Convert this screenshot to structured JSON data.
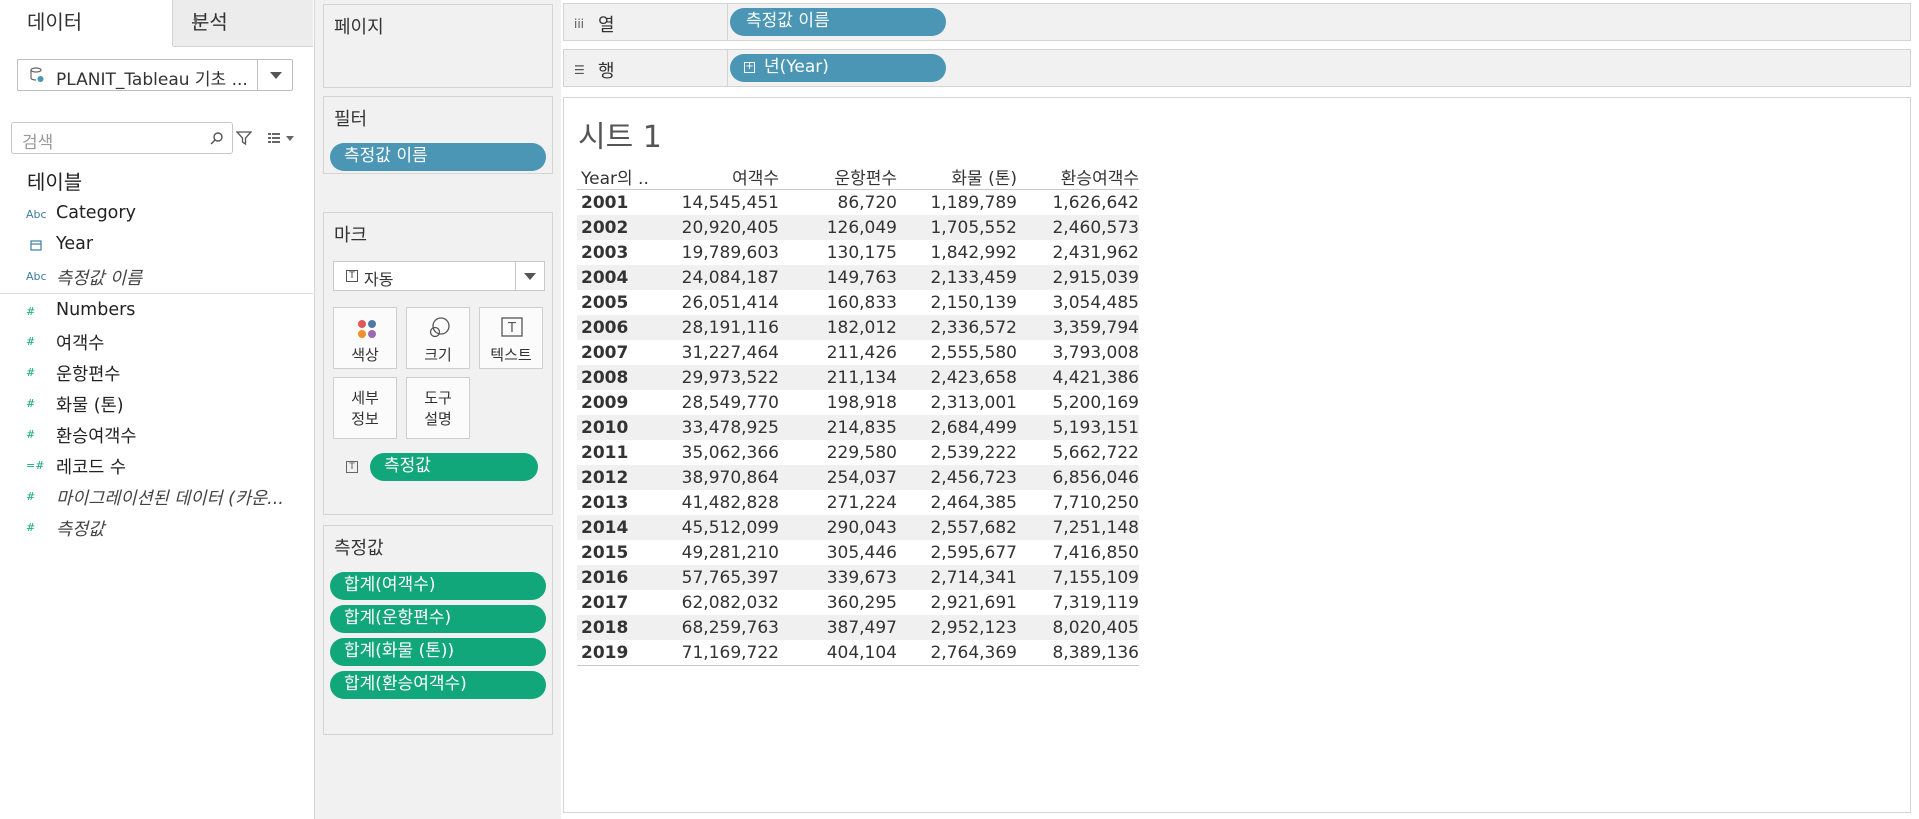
{
  "left_panel": {
    "tabs": {
      "data": "데이터",
      "analysis": "분석"
    },
    "datasource": "PLANIT_Tableau 기초 ...",
    "search_placeholder": "검색",
    "section_title": "테이블",
    "dimensions": [
      {
        "icon": "Abc",
        "label": "Category"
      },
      {
        "icon": "calendar",
        "label": "Year"
      },
      {
        "icon": "Abc",
        "label": "측정값 이름"
      }
    ],
    "measures": [
      {
        "icon": "#",
        "label": "Numbers"
      },
      {
        "icon": "#",
        "label": "여객수"
      },
      {
        "icon": "#",
        "label": "운항편수"
      },
      {
        "icon": "#",
        "label": "화물 (톤)"
      },
      {
        "icon": "#",
        "label": "환승여객수"
      },
      {
        "icon": "=#",
        "label": "레코드 수"
      },
      {
        "icon": "#",
        "label": "마이그레이션된 데이터 (카운..."
      },
      {
        "icon": "#",
        "label": "측정값"
      }
    ]
  },
  "cards": {
    "pages": {
      "title": "페이지"
    },
    "filters": {
      "title": "필터",
      "pill": "측정값 이름"
    },
    "marks": {
      "title": "마크",
      "type": "자동",
      "buttons": {
        "color": "색상",
        "size": "크기",
        "text": "텍스트",
        "detail": "세부\n정보",
        "tooltip": "도구\n설명"
      },
      "text_pill": "측정값"
    },
    "measure_values": {
      "title": "측정값",
      "pills": [
        "합계(여객수)",
        "합계(운항편수)",
        "합계(화물 (톤))",
        "합계(환승여객수)"
      ]
    }
  },
  "shelves": {
    "columns": {
      "label": "열",
      "pill": "측정값 이름"
    },
    "rows": {
      "label": "행",
      "pill": "년(Year)"
    }
  },
  "view": {
    "sheet_title": "시트 1",
    "headers": [
      "Year의 ..",
      "여객수",
      "운항편수",
      "화물 (톤)",
      "환승여객수"
    ],
    "rows": [
      [
        "2001",
        "14,545,451",
        "86,720",
        "1,189,789",
        "1,626,642"
      ],
      [
        "2002",
        "20,920,405",
        "126,049",
        "1,705,552",
        "2,460,573"
      ],
      [
        "2003",
        "19,789,603",
        "130,175",
        "1,842,992",
        "2,431,962"
      ],
      [
        "2004",
        "24,084,187",
        "149,763",
        "2,133,459",
        "2,915,039"
      ],
      [
        "2005",
        "26,051,414",
        "160,833",
        "2,150,139",
        "3,054,485"
      ],
      [
        "2006",
        "28,191,116",
        "182,012",
        "2,336,572",
        "3,359,794"
      ],
      [
        "2007",
        "31,227,464",
        "211,426",
        "2,555,580",
        "3,793,008"
      ],
      [
        "2008",
        "29,973,522",
        "211,134",
        "2,423,658",
        "4,421,386"
      ],
      [
        "2009",
        "28,549,770",
        "198,918",
        "2,313,001",
        "5,200,169"
      ],
      [
        "2010",
        "33,478,925",
        "214,835",
        "2,684,499",
        "5,193,151"
      ],
      [
        "2011",
        "35,062,366",
        "229,580",
        "2,539,222",
        "5,662,722"
      ],
      [
        "2012",
        "38,970,864",
        "254,037",
        "2,456,723",
        "6,856,046"
      ],
      [
        "2013",
        "41,482,828",
        "271,224",
        "2,464,385",
        "7,710,250"
      ],
      [
        "2014",
        "45,512,099",
        "290,043",
        "2,557,682",
        "7,251,148"
      ],
      [
        "2015",
        "49,281,210",
        "305,446",
        "2,595,677",
        "7,416,850"
      ],
      [
        "2016",
        "57,765,397",
        "339,673",
        "2,714,341",
        "7,155,109"
      ],
      [
        "2017",
        "62,082,032",
        "360,295",
        "2,921,691",
        "7,319,119"
      ],
      [
        "2018",
        "68,259,763",
        "387,497",
        "2,952,123",
        "8,020,405"
      ],
      [
        "2019",
        "71,169,722",
        "404,104",
        "2,764,369",
        "8,389,136"
      ]
    ]
  },
  "colors": {
    "blue_pill": "#4a96b4",
    "green_pill": "#12a77a"
  }
}
